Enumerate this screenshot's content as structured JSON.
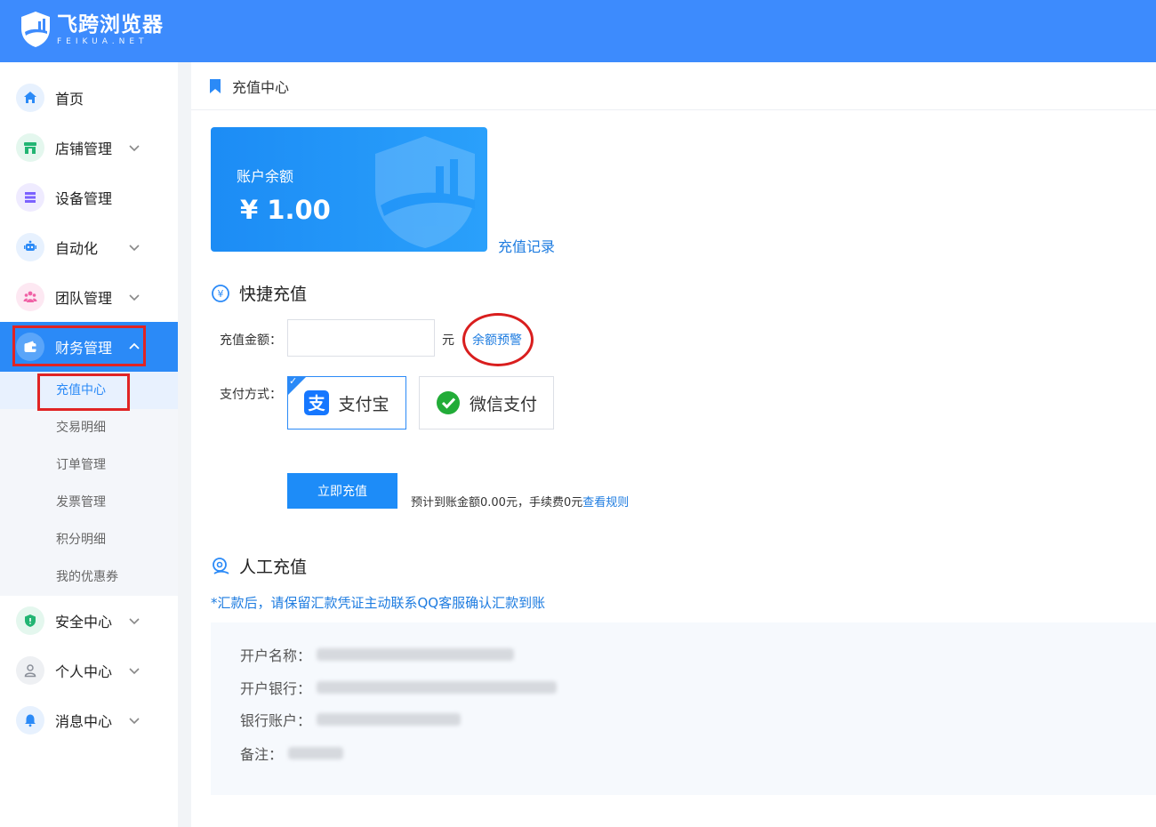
{
  "brand": {
    "title": "飞跨浏览器",
    "subtitle": "FEIKUA.NET"
  },
  "sidebar": {
    "items": [
      {
        "label": "首页",
        "icon": "home-icon",
        "color": "#2b8af7"
      },
      {
        "label": "店铺管理",
        "icon": "store-icon",
        "color": "#22b573"
      },
      {
        "label": "设备管理",
        "icon": "device-icon",
        "color": "#7b61ff"
      },
      {
        "label": "自动化",
        "icon": "robot-icon",
        "color": "#2b8af7"
      },
      {
        "label": "团队管理",
        "icon": "team-icon",
        "color": "#f062a6"
      },
      {
        "label": "财务管理",
        "icon": "wallet-icon",
        "color": "#2b8af7"
      },
      {
        "label": "安全中心",
        "icon": "shield-icon",
        "color": "#22b573"
      },
      {
        "label": "个人中心",
        "icon": "user-icon",
        "color": "#8a8f99"
      },
      {
        "label": "消息中心",
        "icon": "bell-icon",
        "color": "#2b8af7"
      }
    ],
    "finance_sub": [
      "充值中心",
      "交易明细",
      "订单管理",
      "发票管理",
      "积分明细",
      "我的优惠券"
    ]
  },
  "breadcrumb": {
    "title": "充值中心"
  },
  "balance": {
    "label": "账户余额",
    "value": "¥ 1.00",
    "record_link": "充值记录"
  },
  "quick": {
    "title": "快捷充值",
    "amount_label": "充值金额：",
    "amount_value": "",
    "unit": "元",
    "warn_link": "余额预警",
    "pay_label": "支付方式：",
    "pay_options": [
      "支付宝",
      "微信支付"
    ],
    "selected_pay": "支付宝",
    "submit": "立即充值",
    "estimate_text": "预计到账金额0.00元，手续费0元",
    "rules_link": "查看规则"
  },
  "manual": {
    "title": "人工充值",
    "notice": "*汇款后，请保留汇款凭证主动联系QQ客服确认汇款到账",
    "rows": [
      {
        "label": "开户名称："
      },
      {
        "label": "开户银行："
      },
      {
        "label": "银行账户："
      },
      {
        "label": "备注："
      }
    ]
  },
  "colors": {
    "header": "#3d8bfd",
    "accent": "#2b8af7",
    "link": "#1e7ce0",
    "highlight": "#e02424"
  }
}
